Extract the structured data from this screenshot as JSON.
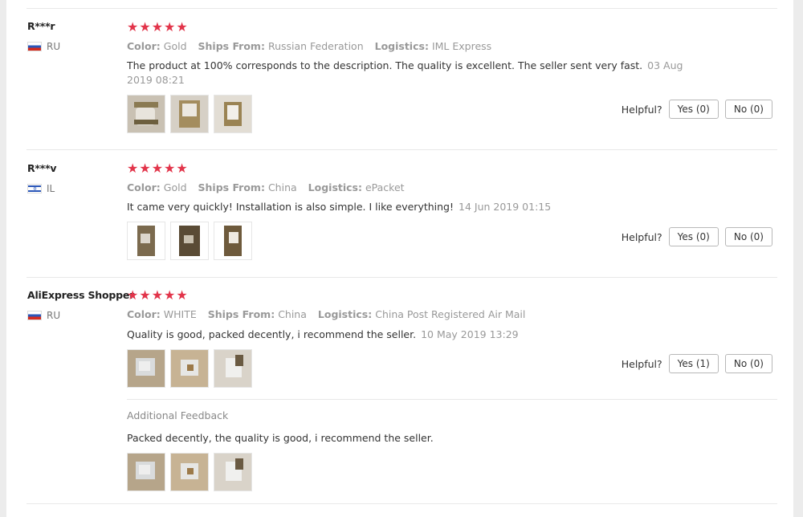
{
  "reviews": [
    {
      "user": "R***r",
      "country": "RU",
      "stars": "★★★★★",
      "color_label": "Color:",
      "color": "Gold",
      "ships_label": "Ships From:",
      "ships": "Russian Federation",
      "logistics_label": "Logistics:",
      "logistics": "IML Express",
      "text": "The product at 100% corresponds to the description. The quality is excellent. The seller sent very fast.",
      "date": "03 Aug 2019 08:21",
      "helpful_label": "Helpful?",
      "yes": "Yes (0)",
      "no": "No (0)"
    },
    {
      "user": "R***v",
      "country": "IL",
      "stars": "★★★★★",
      "color_label": "Color:",
      "color": "Gold",
      "ships_label": "Ships From:",
      "ships": "China",
      "logistics_label": "Logistics:",
      "logistics": "ePacket",
      "text": "It came very quickly! Installation is also simple. I like everything!",
      "date": "14 Jun 2019 01:15",
      "helpful_label": "Helpful?",
      "yes": "Yes (0)",
      "no": "No (0)"
    },
    {
      "user": "AliExpress Shopper",
      "country": "RU",
      "stars": "★★★★★",
      "color_label": "Color:",
      "color": "WHITE",
      "ships_label": "Ships From:",
      "ships": "China",
      "logistics_label": "Logistics:",
      "logistics": "China Post Registered Air Mail",
      "text": "Quality is good, packed decently, i recommend the seller.",
      "date": "10 May 2019 13:29",
      "helpful_label": "Helpful?",
      "yes": "Yes (1)",
      "no": "No (0)",
      "additional_title": "Additional Feedback",
      "additional_text": "Packed decently, the quality is good, i recommend the seller."
    }
  ],
  "colors": {
    "star": "#e2344a",
    "muted": "#999999"
  }
}
